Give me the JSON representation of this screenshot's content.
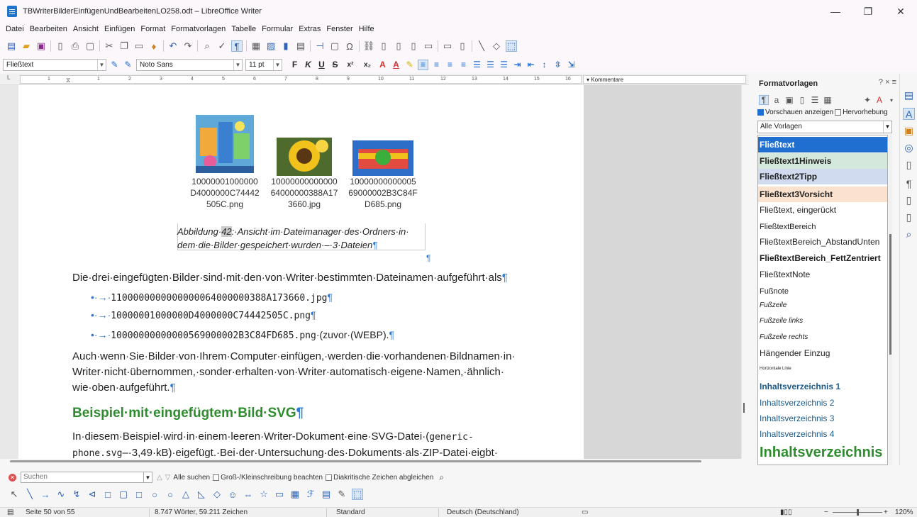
{
  "window": {
    "title": "TBWriterBilderEinfügenUndBearbeitenLO258.odt – LibreOffice Writer",
    "minimize": "—",
    "restore": "❐",
    "close": "✕"
  },
  "menu": [
    "Datei",
    "Bearbeiten",
    "Ansicht",
    "Einfügen",
    "Format",
    "Formatvorlagen",
    "Tabelle",
    "Formular",
    "Extras",
    "Fenster",
    "Hilfe"
  ],
  "formatbar": {
    "paragraph_style": "Fließtext",
    "font_name": "Noto Sans",
    "font_size": "11 pt",
    "bold": "F",
    "italic": "K",
    "underline": "U",
    "strike": "S",
    "superscript": "x²",
    "subscript": "x₂"
  },
  "ruler": {
    "numbers": [
      "1",
      "1",
      "2",
      "3",
      "4",
      "5",
      "6",
      "7",
      "8",
      "9",
      "10",
      "11",
      "12",
      "13",
      "14",
      "15",
      "16",
      "17",
      "18"
    ],
    "comments_label": "▾ Kommentare"
  },
  "document": {
    "thumbnails": [
      {
        "line1": "10000001000000",
        "line2": "D4000000C74442",
        "line3": "505C.png"
      },
      {
        "line1": "10000000000000",
        "line2": "64000000388A17",
        "line3": "3660.jpg"
      },
      {
        "line1": "10000000000005",
        "line2": "69000002B3C84F",
        "line3": "D685.png"
      }
    ],
    "caption_line1_a": "Abbildung·",
    "caption_num": "42",
    "caption_line1_b": ":·Ansicht·im·Dateimanager·des·Ordners·in·",
    "caption_line2": "dem·die·Bilder·gespeichert·wurden·–·3·Dateien",
    "pilcrow": "¶",
    "para1": "Die·drei·eingefügten·Bilder·sind·mit·den·von·Writer·bestimmten·Dateinamen·aufgeführt·als",
    "list": [
      {
        "bullet": "•·→·",
        "file": "1100000000000000064000000388A173660.jpg",
        "suffix": ""
      },
      {
        "bullet": "•·→·",
        "file": "10000001000000D4000000C74442505C.png",
        "suffix": ""
      },
      {
        "bullet": "•·→·",
        "file": "10000000000000569000002B3C84FD685.png",
        "suffix": "·(zuvor·(WEBP)."
      }
    ],
    "para2_line1": "Auch·wenn·Sie·Bilder·von·Ihrem·Computer·einfügen,·werden·die·vorhandenen·Bildnamen·in·",
    "para2_line2": "Writer·nicht·übernommen,·sonder·erhalten·von·Writer·automatisch·eigene·Namen,·ähnlich·",
    "para2_line3": "wie·oben·aufgeführt.",
    "heading": "Beispiel·mit·eingefügtem·Bild·SVG",
    "para3_line1_a": "In·diesem·Beispiel·wird·in·einem·leeren·Writer-Dokument·eine·SVG-Datei·(",
    "para3_line1_b": "generic-",
    "para3_line2_a": "phone.svg",
    "para3_line2_b": "–·3,49·kB)·eigefügt.·Bei·der·Untersuchung·des·Dokuments·als·ZIP-Datei·eigbt·"
  },
  "sidebar": {
    "title": "Formatvorlagen",
    "title_controls": "? ×  ≡",
    "preview_label": "Vorschauen anzeigen",
    "highlight_label": "Hervorhebung",
    "filter": "Alle Vorlagen",
    "styles": [
      {
        "name": "Fließtext",
        "selected": true
      },
      {
        "name": "Fließtext1Hinweis"
      },
      {
        "name": "Fließtext2Tipp"
      },
      {
        "name": "Fließtext3Vorsicht"
      },
      {
        "name": "Fließtext, eingerückt"
      },
      {
        "name": "FließtextBereich"
      },
      {
        "name": "FließtextBereich_AbstandUnten"
      },
      {
        "name": "FließtextBereich_FettZentriert"
      },
      {
        "name": "FließtextNote"
      },
      {
        "name": "Fußnote"
      },
      {
        "name": "Fußzeile"
      },
      {
        "name": "Fußzeile links"
      },
      {
        "name": "Fußzeile rechts"
      },
      {
        "name": "Hängender Einzug"
      },
      {
        "name": "Horizontale Linie"
      },
      {
        "name": "Inhaltsverzeichnis 1"
      },
      {
        "name": "Inhaltsverzeichnis 2"
      },
      {
        "name": "Inhaltsverzeichnis 3"
      },
      {
        "name": "Inhaltsverzeichnis 4"
      },
      {
        "name": "Inhaltsverzeichnis Ü"
      }
    ]
  },
  "findbar": {
    "placeholder": "Suchen",
    "find_all": "Alle suchen",
    "match_case": "Groß-/Kleinschreibung beachten",
    "diacritics": "Diakritische Zeichen abgleichen"
  },
  "statusbar": {
    "page": "Seite 50 von 55",
    "words": "8.747 Wörter, 59.211 Zeichen",
    "page_style": "Standard",
    "language": "Deutsch (Deutschland)",
    "zoom": "120%",
    "zoom_minus": "−",
    "zoom_plus": "+"
  }
}
